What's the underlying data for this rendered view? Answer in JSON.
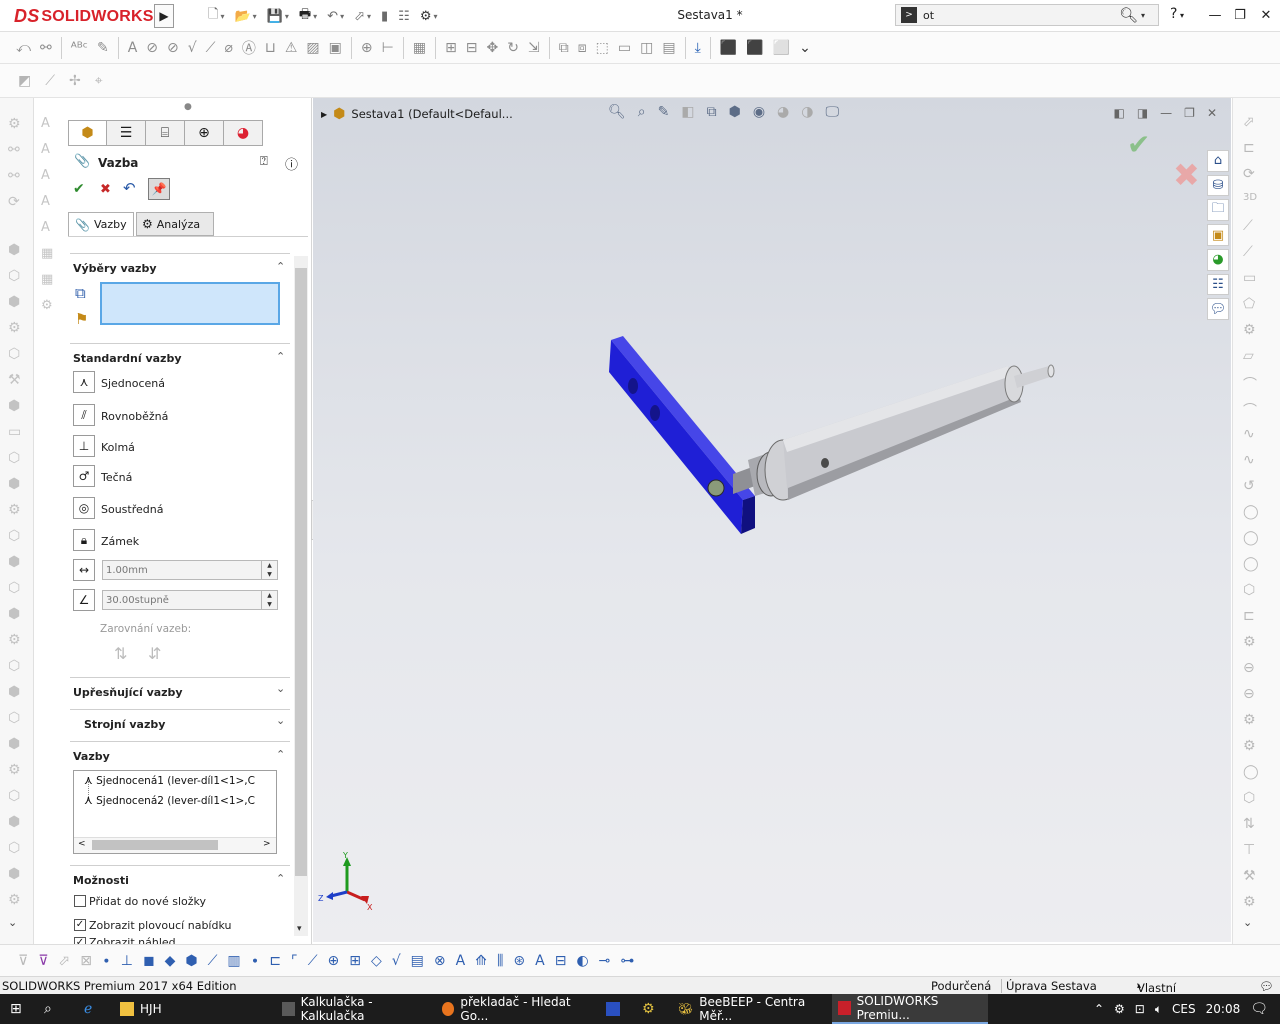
{
  "app": {
    "brand_prefix": "DS",
    "brand": "SOLIDWORKS",
    "document_title": "Sestava1 *"
  },
  "search": {
    "value": "ot",
    "tag": ">"
  },
  "window_controls": {
    "help": "?",
    "minimize": "—",
    "restore": "❐",
    "close": "✕"
  },
  "property_manager": {
    "title": "Vazba",
    "tabs": [
      "Vazby",
      "Analýza"
    ],
    "selections": {
      "header": "Výběry vazby"
    },
    "standard_mates": {
      "header": "Standardní vazby",
      "items": [
        "Sjednocená",
        "Rovnoběžná",
        "Kolmá",
        "Tečná",
        "Soustředná",
        "Zámek"
      ],
      "distance_value": "1.00mm",
      "angle_value": "30.00stupně",
      "alignment_label": "Zarovnání vazeb:"
    },
    "advanced_mates": {
      "header": "Upřesňující vazby"
    },
    "mechanical_mates": {
      "header": "Strojní vazby"
    },
    "mates": {
      "header": "Vazby",
      "items": [
        "Sjednocená1 (lever-díl1<1>,C",
        "Sjednocená2 (lever-díl1<1>,C"
      ]
    },
    "options": {
      "header": "Možnosti",
      "items": [
        {
          "label": "Přidat do nové složky",
          "checked": false
        },
        {
          "label": "Zobrazit plovoucí nabídku",
          "checked": true
        },
        {
          "label": "Zobrazit náhled",
          "checked": true
        }
      ]
    }
  },
  "viewport": {
    "breadcrumb": "Sestava1  (Default<Defaul...",
    "triad": {
      "x": "X",
      "y": "Y",
      "z": "Z"
    },
    "colors": {
      "plate": "#1f1fd6",
      "cylinder": "#c9cacf",
      "background": "#e6e8ed"
    }
  },
  "statusbar": {
    "edition": "SOLIDWORKS Premium 2017 x64 Edition",
    "state": "Podurčená",
    "mode": "Úprava Sestava",
    "units": "Vlastní"
  },
  "taskbar": {
    "items": [
      "HJH",
      "Kalkulačka - Kalkulačka",
      "překladač - Hledat Go...",
      "BeeBEEP - Centra Měř...",
      "SOLIDWORKS Premiu..."
    ],
    "language": "CES",
    "time": "20:08"
  }
}
